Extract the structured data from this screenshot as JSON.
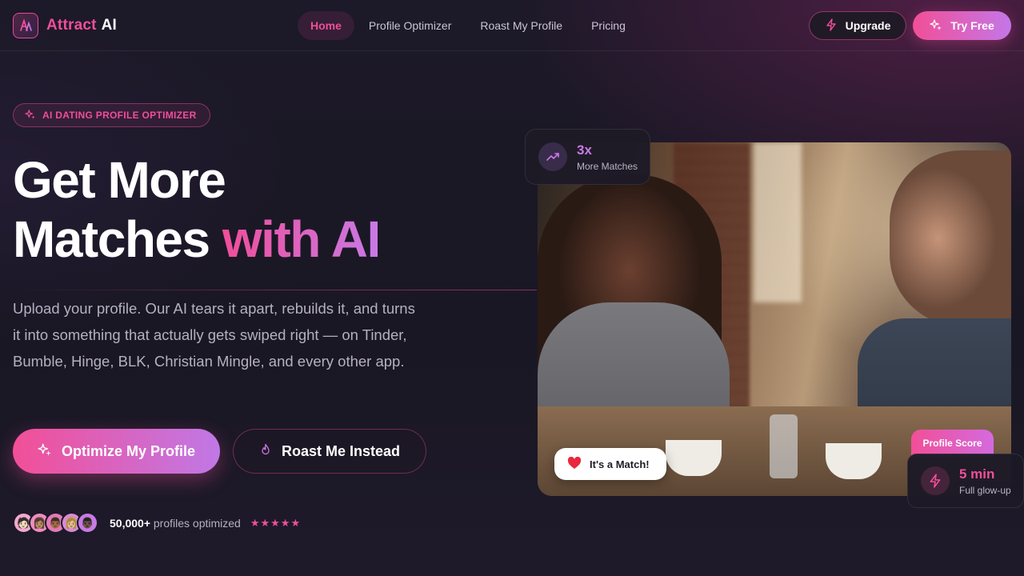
{
  "brand": {
    "name_part1": "Attract",
    "name_part2": "AI"
  },
  "nav": {
    "items": [
      {
        "label": "Home",
        "active": true
      },
      {
        "label": "Profile Optimizer",
        "active": false
      },
      {
        "label": "Roast My Profile",
        "active": false
      },
      {
        "label": "Pricing",
        "active": false
      }
    ],
    "upgrade_label": "Upgrade",
    "try_free_label": "Try Free"
  },
  "hero": {
    "badge": "AI DATING PROFILE OPTIMIZER",
    "headline_line1": "Get More",
    "headline_line2_plain": "Matches",
    "headline_line2_accent": "with AI",
    "subtext": "Upload your profile. Our AI tears it apart, rebuilds it, and turns it into something that actually gets swiped right — on Tinder, Bumble, Hinge, BLK, Christian Mingle, and every other app.",
    "primary_cta": "Optimize My Profile",
    "secondary_cta": "Roast Me Instead",
    "social_count": "50,000+",
    "social_text": "profiles optimized",
    "stars": "★★★★★"
  },
  "cards": {
    "top_stat_value": "3x",
    "top_stat_label": "More Matches",
    "match_label": "It's a Match!",
    "profile_score_label": "Profile Score",
    "bottom_stat_value": "5 min",
    "bottom_stat_label": "Full glow-up"
  },
  "colors": {
    "accent_pink": "#f04e9a",
    "accent_purple": "#c87ae6",
    "background": "#1c1928"
  }
}
